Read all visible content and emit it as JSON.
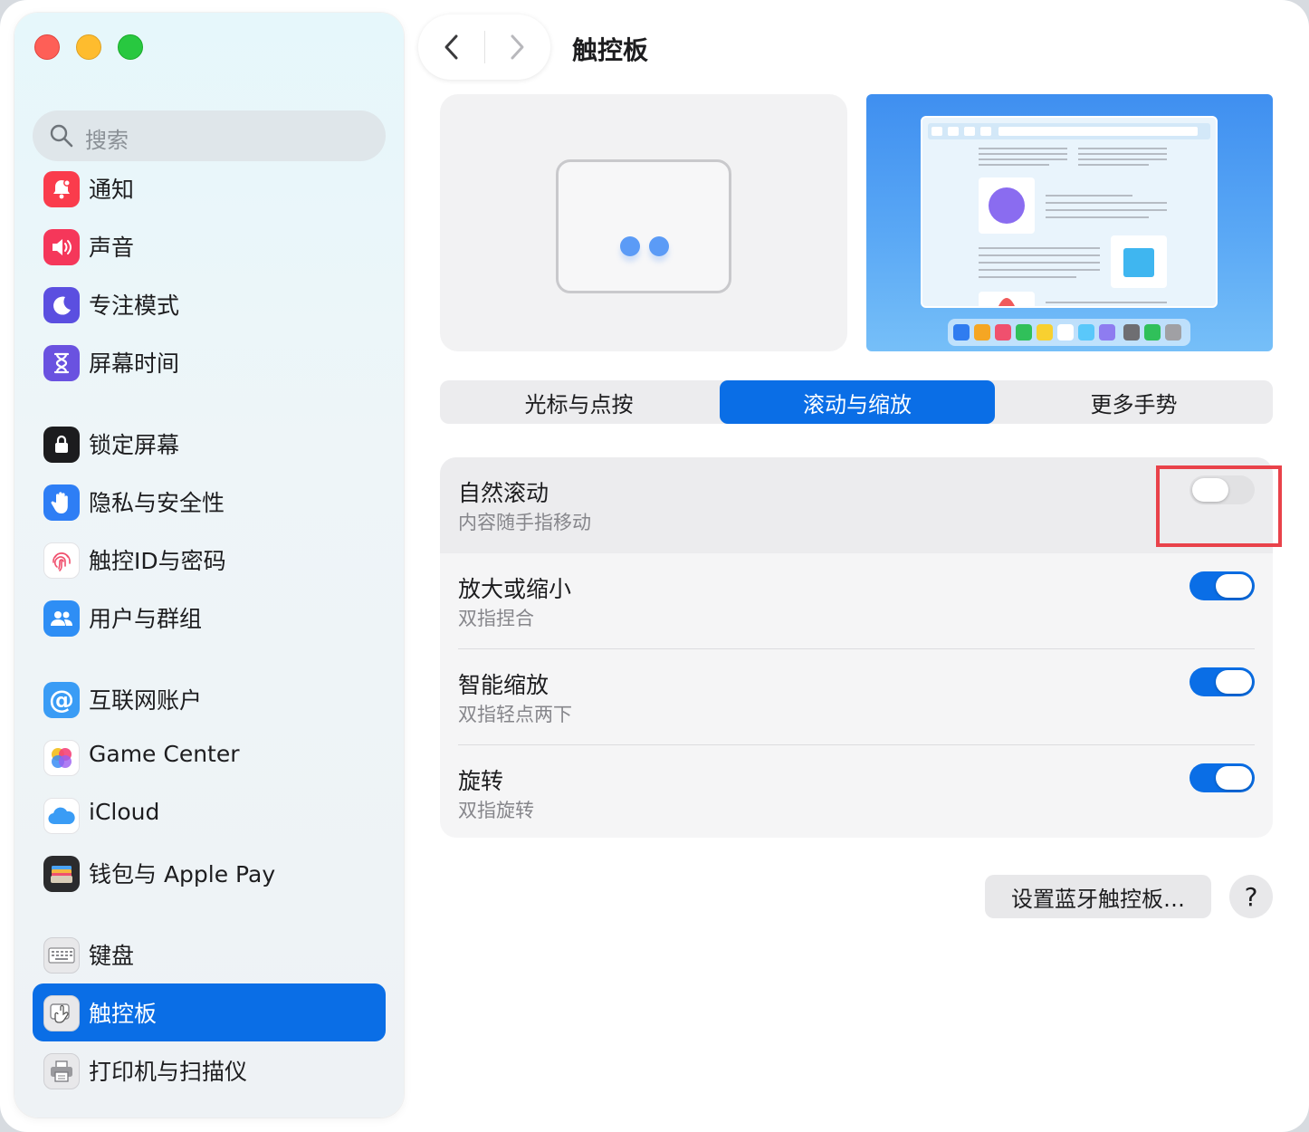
{
  "window": {
    "title": "触控板"
  },
  "sidebar": {
    "search_placeholder": "搜索",
    "items": [
      {
        "label": "通知",
        "icon": "bell-icon",
        "color": "#fa3c4c"
      },
      {
        "label": "声音",
        "icon": "speaker-icon",
        "color": "#f5375a"
      },
      {
        "label": "专注模式",
        "icon": "moon-icon",
        "color": "#5b4fe0"
      },
      {
        "label": "屏幕时间",
        "icon": "hourglass-icon",
        "color": "#6a52e0"
      },
      {
        "label": "锁定屏幕",
        "icon": "lock-icon",
        "color": "#1c1c1e"
      },
      {
        "label": "隐私与安全性",
        "icon": "hand-icon",
        "color": "#2e7ef5"
      },
      {
        "label": "触控ID与密码",
        "icon": "fingerprint-icon",
        "color": "#ffffff"
      },
      {
        "label": "用户与群组",
        "icon": "users-icon",
        "color": "#2e8ef5"
      },
      {
        "label": "互联网账户",
        "icon": "at-icon",
        "color": "#3a9cf5"
      },
      {
        "label": "Game Center",
        "icon": "game-center-icon",
        "color": "#ffffff"
      },
      {
        "label": "iCloud",
        "icon": "cloud-icon",
        "color": "#ffffff"
      },
      {
        "label": "钱包与 Apple Pay",
        "icon": "wallet-icon",
        "color": "#2b2b2d"
      },
      {
        "label": "键盘",
        "icon": "keyboard-icon",
        "color": "#e8e8ea"
      },
      {
        "label": "触控板",
        "icon": "trackpad-icon",
        "color": "#e8e8ea",
        "selected": true
      },
      {
        "label": "打印机与扫描仪",
        "icon": "printer-icon",
        "color": "#e8e8ea"
      }
    ]
  },
  "tabs": [
    {
      "label": "光标与点按",
      "selected": false
    },
    {
      "label": "滚动与缩放",
      "selected": true
    },
    {
      "label": "更多手势",
      "selected": false
    }
  ],
  "settings": [
    {
      "title": "自然滚动",
      "subtitle": "内容随手指移动",
      "enabled": false
    },
    {
      "title": "放大或缩小",
      "subtitle": "双指捏合",
      "enabled": true
    },
    {
      "title": "智能缩放",
      "subtitle": "双指轻点两下",
      "enabled": true
    },
    {
      "title": "旋转",
      "subtitle": "双指旋转",
      "enabled": true
    }
  ],
  "buttons": {
    "bluetooth_setup": "设置蓝牙触控板…",
    "help": "?"
  },
  "colors": {
    "accent": "#0a6ee6",
    "highlight_frame": "#e9424a"
  }
}
